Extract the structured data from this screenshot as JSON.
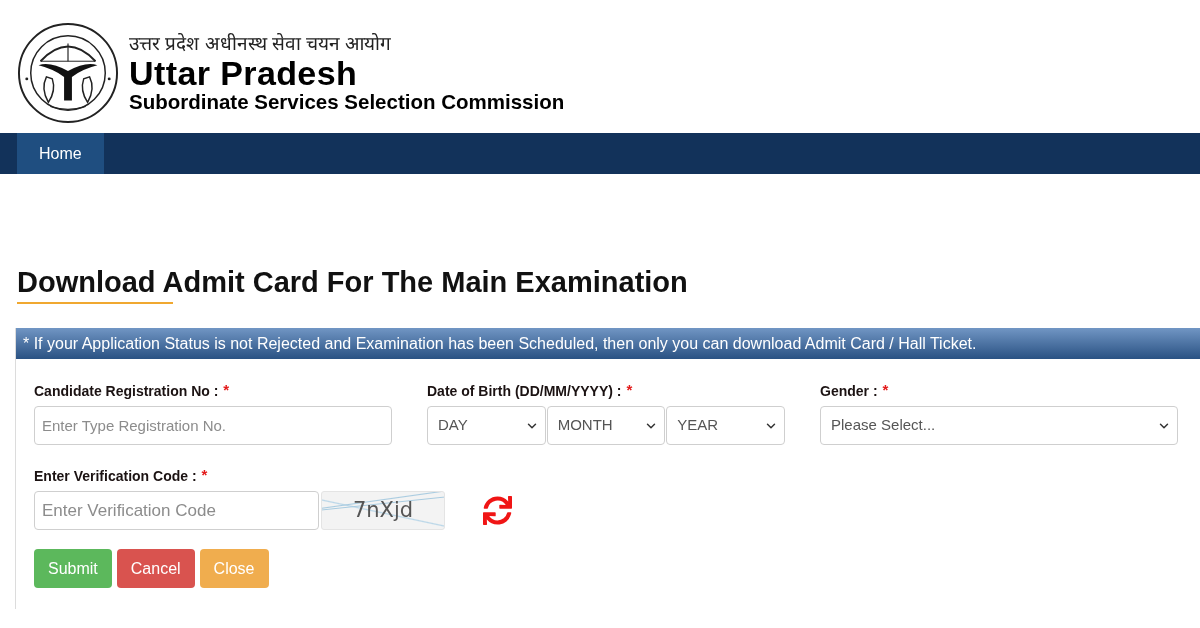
{
  "header": {
    "hindi_title": "उत्तर प्रदेश अधीनस्थ सेवा चयन आयोग",
    "title": "Uttar Pradesh",
    "subtitle": "Subordinate Services Selection Commission"
  },
  "nav": {
    "items": [
      {
        "label": "Home",
        "selected": true
      }
    ]
  },
  "page_title": "Download Admit Card For The Main Examination",
  "form": {
    "notice": "* If your Application Status is not Rejected and Examination has been Scheduled, then only you can download Admit Card / Hall Ticket.",
    "fields": [
      {
        "kind": "text",
        "label": "Candidate Registration No :",
        "required_mark": "*",
        "placeholder": "Enter Type Registration No."
      },
      {
        "kind": "date",
        "label": "Date of Birth (DD/MM/YYYY) :",
        "required_mark": "*",
        "parts": [
          {
            "value": "DAY"
          },
          {
            "value": "MONTH"
          },
          {
            "value": "YEAR"
          }
        ]
      },
      {
        "kind": "select",
        "label": "Gender :",
        "required_mark": "*",
        "value": "Please Select..."
      }
    ],
    "verification": {
      "label": "Enter Verification Code :",
      "required_mark": "*",
      "placeholder": "Enter Verification Code",
      "captcha": "7nXjd"
    },
    "buttons": [
      {
        "label": "Submit",
        "kind": "success"
      },
      {
        "label": "Cancel",
        "kind": "danger"
      },
      {
        "label": "Close",
        "kind": "warning"
      }
    ]
  }
}
